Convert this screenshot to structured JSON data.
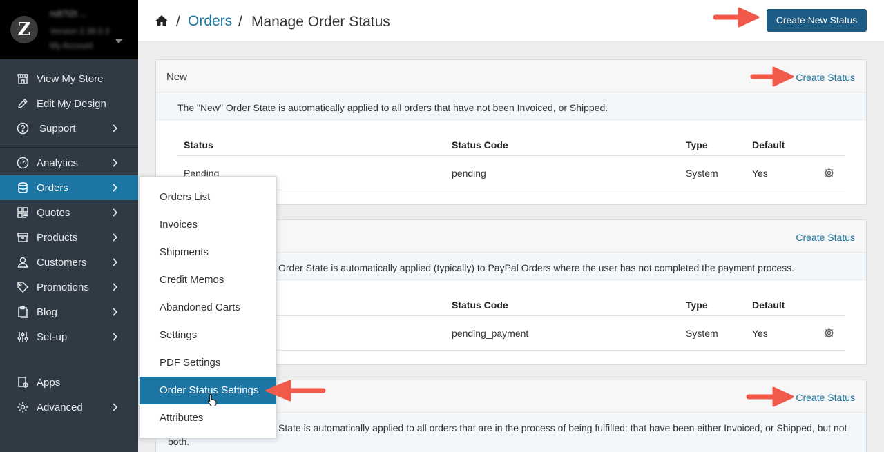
{
  "sidebar": {
    "logo_letter": "Z",
    "account_lines": [
      "ndt7t2t ...",
      "Version 2.38.0.3",
      "My Account"
    ],
    "items": [
      {
        "label": "View My Store",
        "icon": "store-icon"
      },
      {
        "label": "Edit My Design",
        "icon": "pencil-icon"
      },
      {
        "label": "Support",
        "icon": "question-icon"
      },
      {
        "label": "Analytics",
        "icon": "gauge-icon"
      },
      {
        "label": "Orders",
        "icon": "database-icon"
      },
      {
        "label": "Quotes",
        "icon": "quotes-icon"
      },
      {
        "label": "Products",
        "icon": "box-icon"
      },
      {
        "label": "Customers",
        "icon": "user-icon"
      },
      {
        "label": "Promotions",
        "icon": "tag-icon"
      },
      {
        "label": "Blog",
        "icon": "clipboard-icon"
      },
      {
        "label": "Set-up",
        "icon": "sliders-icon"
      },
      {
        "label": "Apps",
        "icon": "apps-icon"
      },
      {
        "label": "Advanced",
        "icon": "gear-icon"
      }
    ]
  },
  "header": {
    "breadcrumb_sep": "/",
    "breadcrumb_link": "Orders",
    "breadcrumb_current": "Manage Order Status",
    "create_button": "Create New Status"
  },
  "columns": {
    "status": "Status",
    "code": "Status Code",
    "type": "Type",
    "default": "Default"
  },
  "panels": [
    {
      "title": "New",
      "link": "Create Status",
      "description": "The \"New\" Order State is automatically applied to all orders that have not been Invoiced, or Shipped.",
      "row": {
        "status": "Pending",
        "code": "pending",
        "type": "System",
        "default": "Yes"
      }
    },
    {
      "title": "",
      "link": "Create Status",
      "description": "Order State is automatically applied (typically) to PayPal Orders where the user has not completed the payment process.",
      "row": {
        "status": "",
        "code": "pending_payment",
        "type": "System",
        "default": "Yes"
      }
    },
    {
      "title": "",
      "link": "Create Status",
      "description": "State is automatically applied to all orders that are in the process of being fulfilled: that have been either Invoiced, or Shipped, but not both."
    }
  ],
  "dropdown": {
    "items": [
      "Orders List",
      "Invoices",
      "Shipments",
      "Credit Memos",
      "Abandoned Carts",
      "Settings",
      "PDF Settings",
      "Order Status Settings",
      "Attributes"
    ],
    "active_index": 7
  },
  "colors": {
    "accent": "#1d76a3",
    "sidebar": "#2f3a44",
    "arrow": "#f05a4b",
    "button": "#1d5c85"
  }
}
